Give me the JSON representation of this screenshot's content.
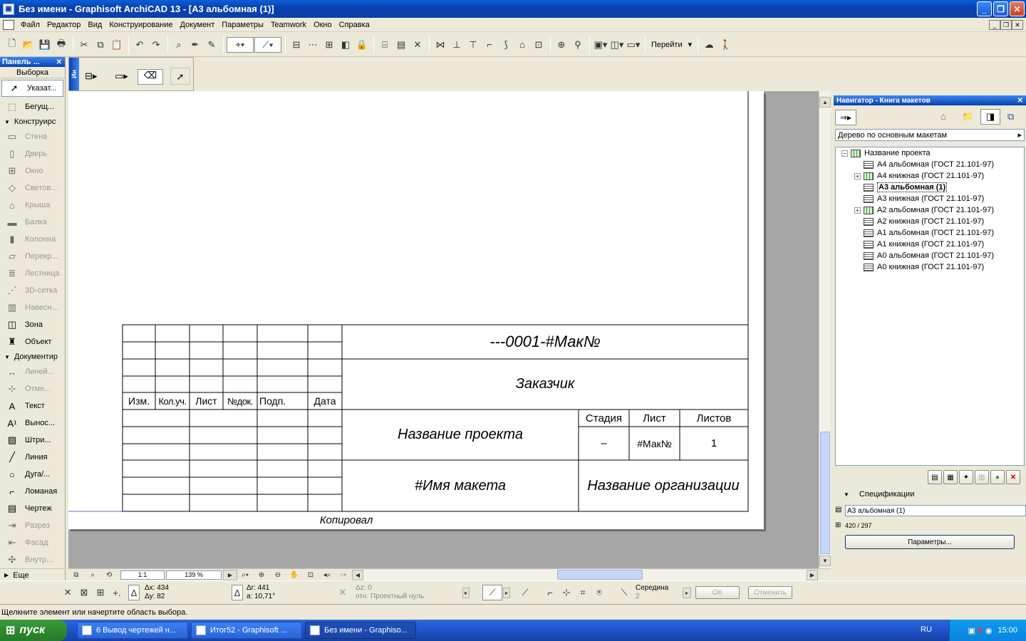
{
  "window": {
    "title": "Без имени - Graphisoft ArchiCAD 13 - [А3 альбомная (1)]"
  },
  "menu": [
    "Файл",
    "Редактор",
    "Вид",
    "Конструирование",
    "Документ",
    "Параметры",
    "Teamwork",
    "Окно",
    "Справка"
  ],
  "toolbar": {
    "goto_label": "Перейти"
  },
  "toolbox": {
    "title": "Панель ...",
    "selection_header": "Выборка",
    "selection_items": [
      {
        "label": "Указат...",
        "icon": "arrow-icon"
      },
      {
        "label": "Бегущ...",
        "icon": "marquee-icon"
      }
    ],
    "group_design": "Конструирс",
    "design_items": [
      {
        "label": "Стена",
        "icon": "wall-icon"
      },
      {
        "label": "Дверь",
        "icon": "door-icon"
      },
      {
        "label": "Окно",
        "icon": "window-icon"
      },
      {
        "label": "Светов...",
        "icon": "skylight-icon"
      },
      {
        "label": "Крыша",
        "icon": "roof-icon"
      },
      {
        "label": "Балка",
        "icon": "beam-icon"
      },
      {
        "label": "Колонна",
        "icon": "column-icon"
      },
      {
        "label": "Перекр...",
        "icon": "slab-icon"
      },
      {
        "label": "Лестница",
        "icon": "stair-icon"
      },
      {
        "label": "3D-сетка",
        "icon": "mesh-icon"
      },
      {
        "label": "Навесн...",
        "icon": "curtain-wall-icon"
      },
      {
        "label": "Зона",
        "icon": "zone-icon"
      },
      {
        "label": "Объект",
        "icon": "object-icon"
      }
    ],
    "group_document": "Документир",
    "document_items": [
      {
        "label": "Линей...",
        "icon": "dimension-icon"
      },
      {
        "label": "Отме...",
        "icon": "level-icon"
      },
      {
        "label": "Текст",
        "icon": "text-icon"
      },
      {
        "label": "Вынос...",
        "icon": "label-icon"
      },
      {
        "label": "Штри...",
        "icon": "fill-icon"
      },
      {
        "label": "Линия",
        "icon": "line-icon"
      },
      {
        "label": "Дуга/...",
        "icon": "arc-icon"
      },
      {
        "label": "Ломаная",
        "icon": "polyline-icon"
      },
      {
        "label": "Чертеж",
        "icon": "drawing-icon"
      },
      {
        "label": "Разрез",
        "icon": "section-icon"
      },
      {
        "label": "Фасад",
        "icon": "elevation-icon"
      },
      {
        "label": "Внутр...",
        "icon": "interior-icon"
      }
    ],
    "more": "Еще"
  },
  "infobox": {
    "side_label": "Ин"
  },
  "stamp": {
    "code": "---0001-#Мак№",
    "customer": "Заказчик",
    "project_name": "Название проекта",
    "layout_name": "#Имя макета",
    "organization": "Название организации",
    "headers": [
      "Изм.",
      "Кол.уч.",
      "Лист",
      "№док.",
      "Подп.",
      "Дата"
    ],
    "stage_header": "Стадия",
    "sheet_header": "Лист",
    "sheets_header": "Листов",
    "stage_value": "–",
    "sheet_value": "#Мак№",
    "sheets_value": "1",
    "copied": "Копировал"
  },
  "zoom": {
    "scale": "1:1",
    "percent": "139 %"
  },
  "navigator": {
    "title": "Навигатор - Книга макетов",
    "view_select": "Дерево по основным макетам",
    "root": "Название проекта",
    "items": [
      {
        "label": "А4 альбомная (ГОСТ 21.101-97)",
        "expandable": false,
        "selected": false
      },
      {
        "label": "А4 книжная (ГОСТ 21.101-97)",
        "expandable": true,
        "selected": false
      },
      {
        "label": "А3 альбомная (1)",
        "expandable": false,
        "selected": true
      },
      {
        "label": "А3 книжная (ГОСТ 21.101-97)",
        "expandable": false,
        "selected": false
      },
      {
        "label": "А2 альбомная (ГОСТ 21.101-97)",
        "expandable": true,
        "selected": false
      },
      {
        "label": "А2 книжная (ГОСТ 21.101-97)",
        "expandable": false,
        "selected": false
      },
      {
        "label": "А1 альбомная (ГОСТ 21.101-97)",
        "expandable": false,
        "selected": false
      },
      {
        "label": "А1 книжная (ГОСТ 21.101-97)",
        "expandable": false,
        "selected": false
      },
      {
        "label": "А0 альбомная (ГОСТ 21.101-97)",
        "expandable": false,
        "selected": false
      },
      {
        "label": "А0 книжная (ГОСТ 21.101-97)",
        "expandable": false,
        "selected": false
      }
    ],
    "specs_label": "Спецификации",
    "spec_name": "А3 альбомная (1)",
    "spec_size": "420 / 297",
    "params_button": "Параметры..."
  },
  "coords": {
    "dx": "Δx: 434",
    "dy": "Δy: 82",
    "dr": "Δr: 441",
    "a": "a: 10,71°",
    "dz": "Δz: 0",
    "ref": "отн. Проектный нуль",
    "snap": "Середина",
    "snap_n": "2",
    "ok": "OK",
    "cancel": "Отменить"
  },
  "status": {
    "text": "Щелкните элемент или начертите область выбора."
  },
  "taskbar": {
    "start": "пуск",
    "tasks": [
      "6 Вывод чертежей н...",
      "Итог52 - Graphisoft ...",
      "Без имени - Graphiso..."
    ],
    "lang": "RU",
    "time": "15:00"
  }
}
